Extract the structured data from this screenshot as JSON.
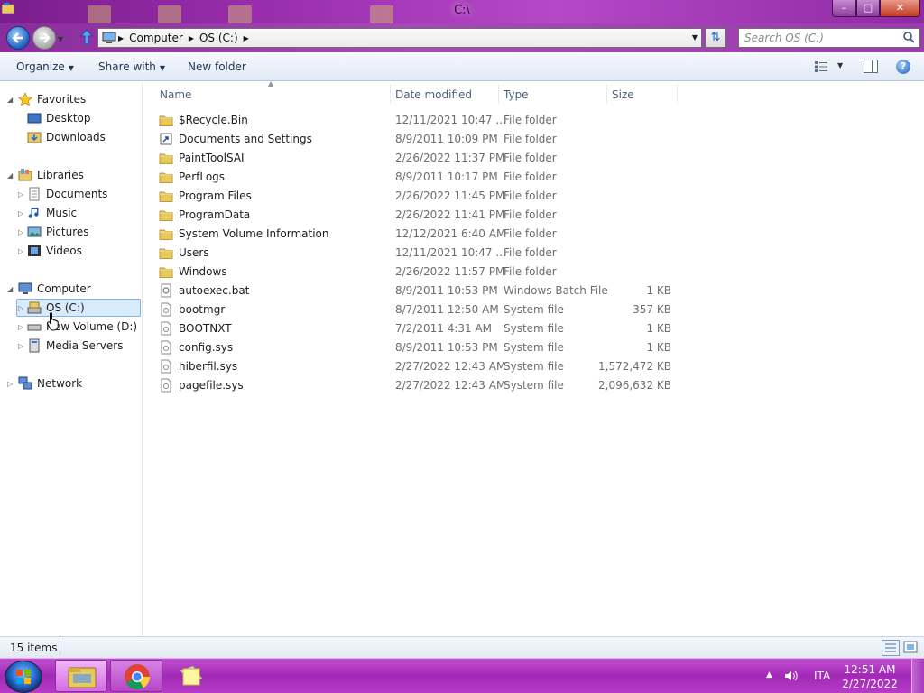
{
  "window": {
    "title": "C:\\"
  },
  "nav": {
    "breadcrumb": [
      "Computer",
      "OS (C:)"
    ],
    "search_placeholder": "Search OS (C:)"
  },
  "toolbar": {
    "organize": "Organize",
    "share_with": "Share with",
    "new_folder": "New folder"
  },
  "sidebar": {
    "favorites": "Favorites",
    "desktop": "Desktop",
    "downloads": "Downloads",
    "libraries": "Libraries",
    "documents": "Documents",
    "music": "Music",
    "pictures": "Pictures",
    "videos": "Videos",
    "computer": "Computer",
    "os_c": "OS (C:)",
    "new_volume": "New Volume (D:)",
    "media_servers": "Media Servers",
    "network": "Network"
  },
  "columns": {
    "name": "Name",
    "date": "Date modified",
    "type": "Type",
    "size": "Size"
  },
  "files": [
    {
      "name": "$Recycle.Bin",
      "date": "12/11/2021 10:47 ...",
      "type": "File folder",
      "size": "",
      "icon": "folder-icon"
    },
    {
      "name": "Documents and Settings",
      "date": "8/9/2011 10:09 PM",
      "type": "File folder",
      "size": "",
      "icon": "shortcut-icon"
    },
    {
      "name": "PaintToolSAI",
      "date": "2/26/2022 11:37 PM",
      "type": "File folder",
      "size": "",
      "icon": "folder-icon"
    },
    {
      "name": "PerfLogs",
      "date": "8/9/2011 10:17 PM",
      "type": "File folder",
      "size": "",
      "icon": "folder-icon"
    },
    {
      "name": "Program Files",
      "date": "2/26/2022 11:45 PM",
      "type": "File folder",
      "size": "",
      "icon": "folder-icon"
    },
    {
      "name": "ProgramData",
      "date": "2/26/2022 11:41 PM",
      "type": "File folder",
      "size": "",
      "icon": "folder-icon"
    },
    {
      "name": "System Volume Information",
      "date": "12/12/2021 6:40 AM",
      "type": "File folder",
      "size": "",
      "icon": "folder-icon"
    },
    {
      "name": "Users",
      "date": "12/11/2021 10:47 ...",
      "type": "File folder",
      "size": "",
      "icon": "folder-icon"
    },
    {
      "name": "Windows",
      "date": "2/26/2022 11:57 PM",
      "type": "File folder",
      "size": "",
      "icon": "folder-icon"
    },
    {
      "name": "autoexec.bat",
      "date": "8/9/2011 10:53 PM",
      "type": "Windows Batch File",
      "size": "1 KB",
      "icon": "batch-file-icon"
    },
    {
      "name": "bootmgr",
      "date": "8/7/2011 12:50 AM",
      "type": "System file",
      "size": "357 KB",
      "icon": "system-file-icon"
    },
    {
      "name": "BOOTNXT",
      "date": "7/2/2011 4:31 AM",
      "type": "System file",
      "size": "1 KB",
      "icon": "system-file-icon"
    },
    {
      "name": "config.sys",
      "date": "8/9/2011 10:53 PM",
      "type": "System file",
      "size": "1 KB",
      "icon": "system-file-icon"
    },
    {
      "name": "hiberfil.sys",
      "date": "2/27/2022 12:43 AM",
      "type": "System file",
      "size": "1,572,472 KB",
      "icon": "system-file-icon"
    },
    {
      "name": "pagefile.sys",
      "date": "2/27/2022 12:43 AM",
      "type": "System file",
      "size": "2,096,632 KB",
      "icon": "system-file-icon"
    }
  ],
  "status": {
    "count": "15 items"
  },
  "taskbar": {
    "lang": "ITA",
    "time": "12:51 AM",
    "date": "2/27/2022"
  }
}
